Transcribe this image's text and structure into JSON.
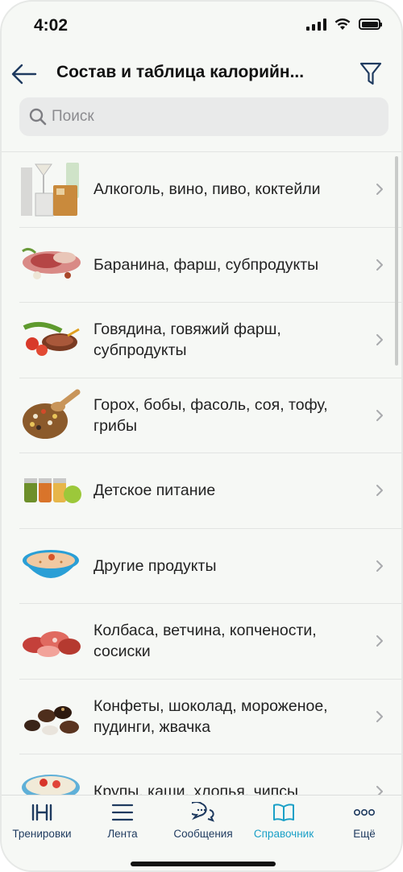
{
  "status": {
    "time": "4:02"
  },
  "navbar": {
    "title": "Состав и таблица калорийн...",
    "back_icon": "arrow-left-icon",
    "filter_icon": "filter-icon"
  },
  "search": {
    "placeholder": "Поиск",
    "value": ""
  },
  "categories": [
    {
      "label": "Алкоголь, вино, пиво, коктейли",
      "icon": "drinks-image"
    },
    {
      "label": "Баранина, фарш, субпродукты",
      "icon": "lamb-image"
    },
    {
      "label": "Говядина, говяжий фарш, субпродукты",
      "icon": "beef-image"
    },
    {
      "label": "Горох, бобы, фасоль, соя, тофу, грибы",
      "icon": "legumes-image"
    },
    {
      "label": "Детское питание",
      "icon": "baby-food-image"
    },
    {
      "label": "Другие продукты",
      "icon": "other-products-image"
    },
    {
      "label": "Колбаса, ветчина, копчености, сосиски",
      "icon": "sausages-image"
    },
    {
      "label": "Конфеты, шоколад, мороженое, пудинги, жвачка",
      "icon": "sweets-image"
    },
    {
      "label": "Крупы, каши, хлопья, чипсы",
      "icon": "cereals-image"
    }
  ],
  "tabbar": {
    "items": [
      {
        "label": "Тренировки",
        "icon": "dumbbell-icon",
        "active": false
      },
      {
        "label": "Лента",
        "icon": "feed-lines-icon",
        "active": false
      },
      {
        "label": "Сообщения",
        "icon": "chat-bubbles-icon",
        "active": false
      },
      {
        "label": "Справочник",
        "icon": "open-book-icon",
        "active": true
      },
      {
        "label": "Ещё",
        "icon": "more-dots-icon",
        "active": false
      }
    ]
  },
  "colors": {
    "accent": "#1aa0c7",
    "tab_inactive": "#1e3a5f",
    "background": "#f6f8f5"
  }
}
